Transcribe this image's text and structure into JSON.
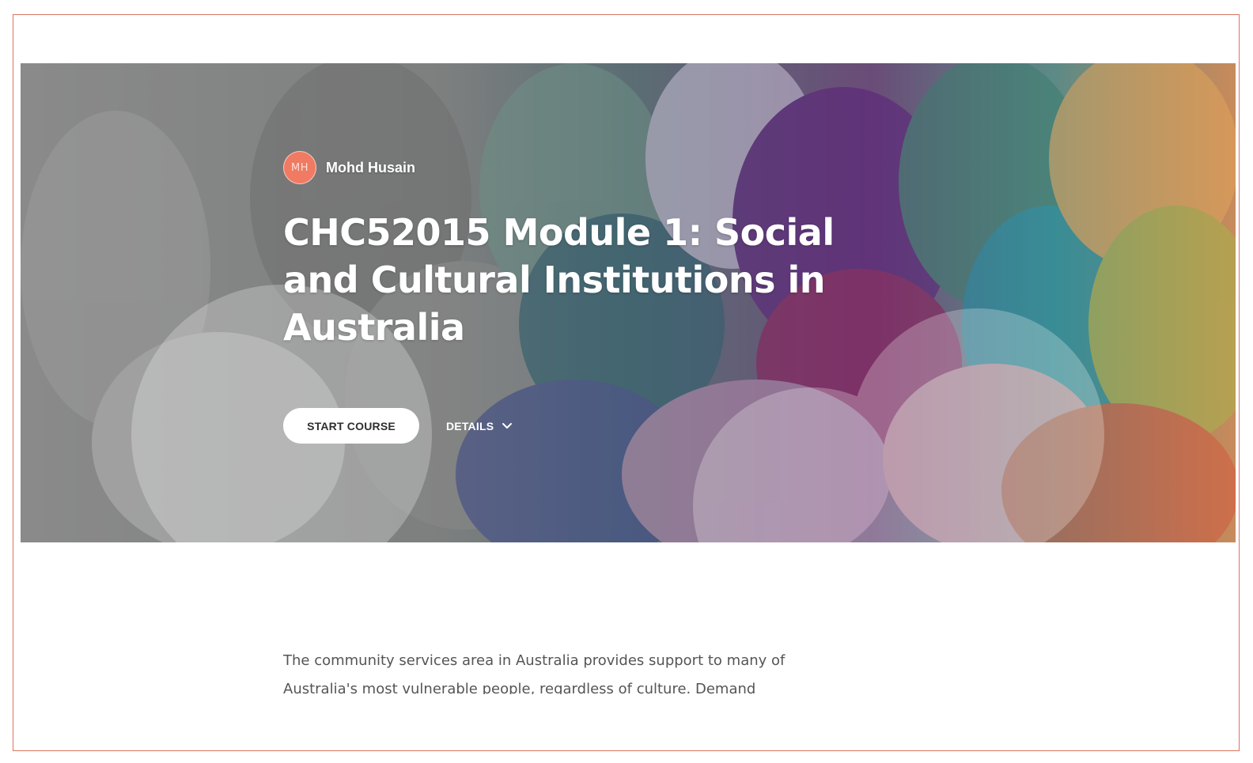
{
  "course": {
    "author_initials": "MH",
    "author_name": "Mohd Husain",
    "title": "CHC52015 Module 1: Social and Cultural Institutions in Australia",
    "start_label": "START COURSE",
    "details_label": "DETAILS",
    "description": "The community services area in Australia provides support to many of Australia's most vulnerable people, regardless of culture. Demand"
  },
  "colors": {
    "frame_border": "#d9735f",
    "avatar_bg": "#f07a62",
    "button_bg": "#ffffff",
    "description_text": "#555555"
  },
  "icons": {
    "details_toggle": "chevron-down-icon"
  }
}
